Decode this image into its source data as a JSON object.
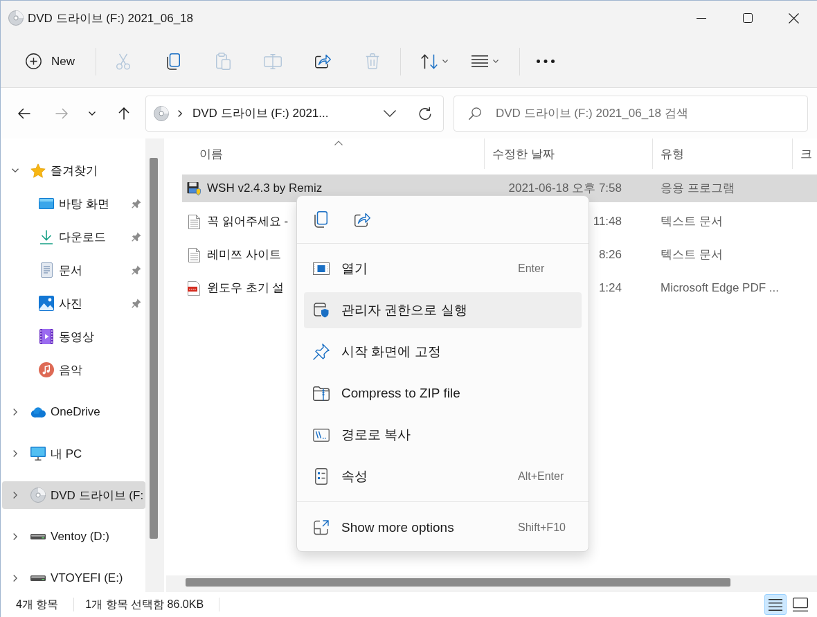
{
  "window": {
    "title": "DVD 드라이브 (F:) 2021_06_18"
  },
  "toolbar": {
    "new_button": {
      "label": "New"
    },
    "actions": [
      {
        "kind": "cut",
        "disabled": true
      },
      {
        "kind": "copy",
        "disabled": false
      },
      {
        "kind": "paste",
        "disabled": true
      },
      {
        "kind": "rename",
        "disabled": true
      },
      {
        "kind": "share",
        "disabled": false
      },
      {
        "kind": "delete",
        "disabled": true
      }
    ],
    "menus": [
      {
        "kind": "sort"
      },
      {
        "kind": "view"
      }
    ]
  },
  "navigation": {
    "buttons": [
      {
        "kind": "back",
        "disabled": false
      },
      {
        "kind": "forward",
        "disabled": true
      },
      {
        "kind": "recent",
        "disabled": false
      },
      {
        "kind": "up",
        "disabled": false
      }
    ],
    "address": "DVD 드라이브 (F:) 2021...",
    "search": {
      "placeholder": "DVD 드라이브 (F:) 2021_06_18 검색"
    }
  },
  "sidebar": {
    "items": [
      {
        "kind": "favorites",
        "label": "즐겨찾기",
        "expanded": true,
        "selected": false,
        "children": [
          {
            "kind": "desktop",
            "label": "바탕 화면",
            "pinned": true,
            "selected": false
          },
          {
            "kind": "downloads",
            "label": "다운로드",
            "pinned": true,
            "selected": false
          },
          {
            "kind": "documents",
            "label": "문서",
            "pinned": true,
            "selected": false
          },
          {
            "kind": "pictures",
            "label": "사진",
            "pinned": true,
            "selected": false
          },
          {
            "kind": "videos",
            "label": "동영상",
            "pinned": false,
            "selected": false
          },
          {
            "kind": "music",
            "label": "음악",
            "pinned": false,
            "selected": false
          }
        ]
      },
      {
        "kind": "cloud",
        "label": "OneDrive",
        "expanded": false,
        "selected": false
      },
      {
        "kind": "pc",
        "label": "내 PC",
        "expanded": false,
        "selected": false
      },
      {
        "kind": "dvd",
        "label": "DVD 드라이브 (F:",
        "expanded": false,
        "selected": true
      },
      {
        "kind": "drive",
        "label": "Ventoy (D:)",
        "expanded": false,
        "selected": false
      },
      {
        "kind": "drive",
        "label": "VTOYEFI (E:)",
        "expanded": false,
        "selected": false
      }
    ]
  },
  "file_list": {
    "columns": [
      {
        "label": "이름",
        "sorted": true
      },
      {
        "label": "수정한 날짜",
        "sorted": false
      },
      {
        "label": "유형",
        "sorted": false
      },
      {
        "label": "크",
        "sorted": false
      }
    ],
    "rows": [
      {
        "kind": "application",
        "name": "WSH v2.4.3 by Remiz",
        "modified": "2021-06-18 오후 7:58",
        "type": "응용 프로그램",
        "selected": true
      },
      {
        "kind": "text",
        "name": "꼭 읽어주세요 -",
        "modified": "11:48",
        "type": "텍스트 문서",
        "selected": false
      },
      {
        "kind": "text",
        "name": "레미쯔 사이트",
        "modified": "8:26",
        "type": "텍스트 문서",
        "selected": false
      },
      {
        "kind": "pdf",
        "name": "윈도우 초기 설",
        "modified": "1:24",
        "type": "Microsoft Edge PDF ...",
        "selected": false
      }
    ]
  },
  "context_menu": {
    "quick_actions": [
      {
        "kind": "copy"
      },
      {
        "kind": "share"
      }
    ],
    "sections": [
      {
        "items": [
          {
            "kind": "open",
            "label": "열기",
            "shortcut": "Enter",
            "hovered": false
          },
          {
            "kind": "run_as_admin",
            "label": "관리자 권한으로 실행",
            "hovered": true
          },
          {
            "kind": "pin",
            "label": "시작 화면에 고정",
            "hovered": false
          },
          {
            "kind": "zip",
            "label": "Compress to ZIP file",
            "hovered": false
          },
          {
            "kind": "copy_path",
            "label": "경로로 복사",
            "hovered": false
          },
          {
            "kind": "properties",
            "label": "속성",
            "shortcut": "Alt+Enter",
            "hovered": false
          }
        ]
      },
      {
        "items": [
          {
            "kind": "more",
            "label": "Show more options",
            "shortcut": "Shift+F10",
            "hovered": false
          }
        ]
      }
    ]
  },
  "status_bar": {
    "item_count": "4개 항목",
    "selection": "1개 항목 선택함 86.0KB",
    "views": [
      {
        "kind": "details",
        "selected": true
      },
      {
        "kind": "tiles",
        "selected": false
      }
    ]
  }
}
